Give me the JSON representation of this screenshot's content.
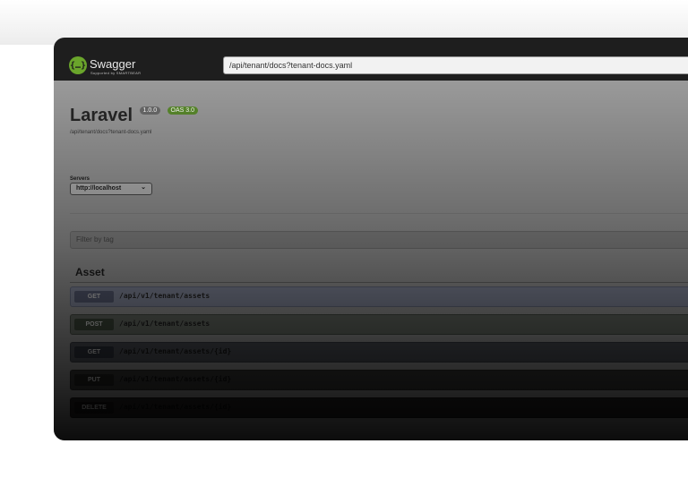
{
  "header": {
    "logo_title": "Swagger",
    "logo_sub": "Supported by SMARTBEAR",
    "url": "/api/tenant/docs?tenant-docs.yaml"
  },
  "info": {
    "title": "Laravel",
    "version": "1.0.0",
    "oas": "OAS 3.0",
    "docs_link": "/api/tenant/docs?tenant-docs.yaml"
  },
  "servers": {
    "label": "Servers",
    "selected": "http://localhost"
  },
  "filter": {
    "placeholder": "Filter by tag"
  },
  "section": {
    "title": "Asset",
    "operations": [
      {
        "method": "GET",
        "path": "/api/v1/tenant/assets"
      },
      {
        "method": "POST",
        "path": "/api/v1/tenant/assets"
      },
      {
        "method": "GET",
        "path": "/api/v1/tenant/assets/{id}"
      },
      {
        "method": "PUT",
        "path": "/api/v1/tenant/assets/{id}"
      },
      {
        "method": "DELETE",
        "path": "/api/v1/tenant/assets/{id}"
      }
    ]
  },
  "colors": {
    "topbar": "#1e1e1e",
    "logo_green": "#6aa52b",
    "oas_badge": "#5a8a2c"
  },
  "icons": {
    "logo": "swagger-logo-icon",
    "chevron": "chevron-down-icon"
  }
}
